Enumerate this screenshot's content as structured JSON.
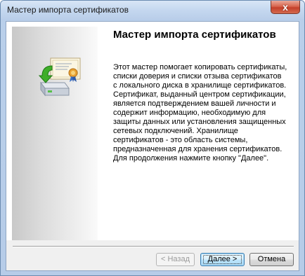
{
  "window": {
    "title": "Мастер импорта сертификатов",
    "close_label": "x"
  },
  "wizard": {
    "heading": "Мастер импорта сертификатов",
    "paragraphs": [
      "Этот мастер помогает копировать сертификаты, списки доверия и списки отзыва сертификатов с локального диска в хранилище сертификатов.",
      "Сертификат, выданный центром сертификации, является подтверждением вашей личности и содержит информацию, необходимую для защиты данных или установления защищенных сетевых подключений. Хранилище сертификатов - это область системы, предназначенная для хранения сертификатов.",
      "Для продолжения нажмите кнопку \"Далее\"."
    ],
    "icon": "certificate-import-icon"
  },
  "buttons": {
    "back": "< Назад",
    "next": "Далее >",
    "cancel": "Отмена"
  }
}
